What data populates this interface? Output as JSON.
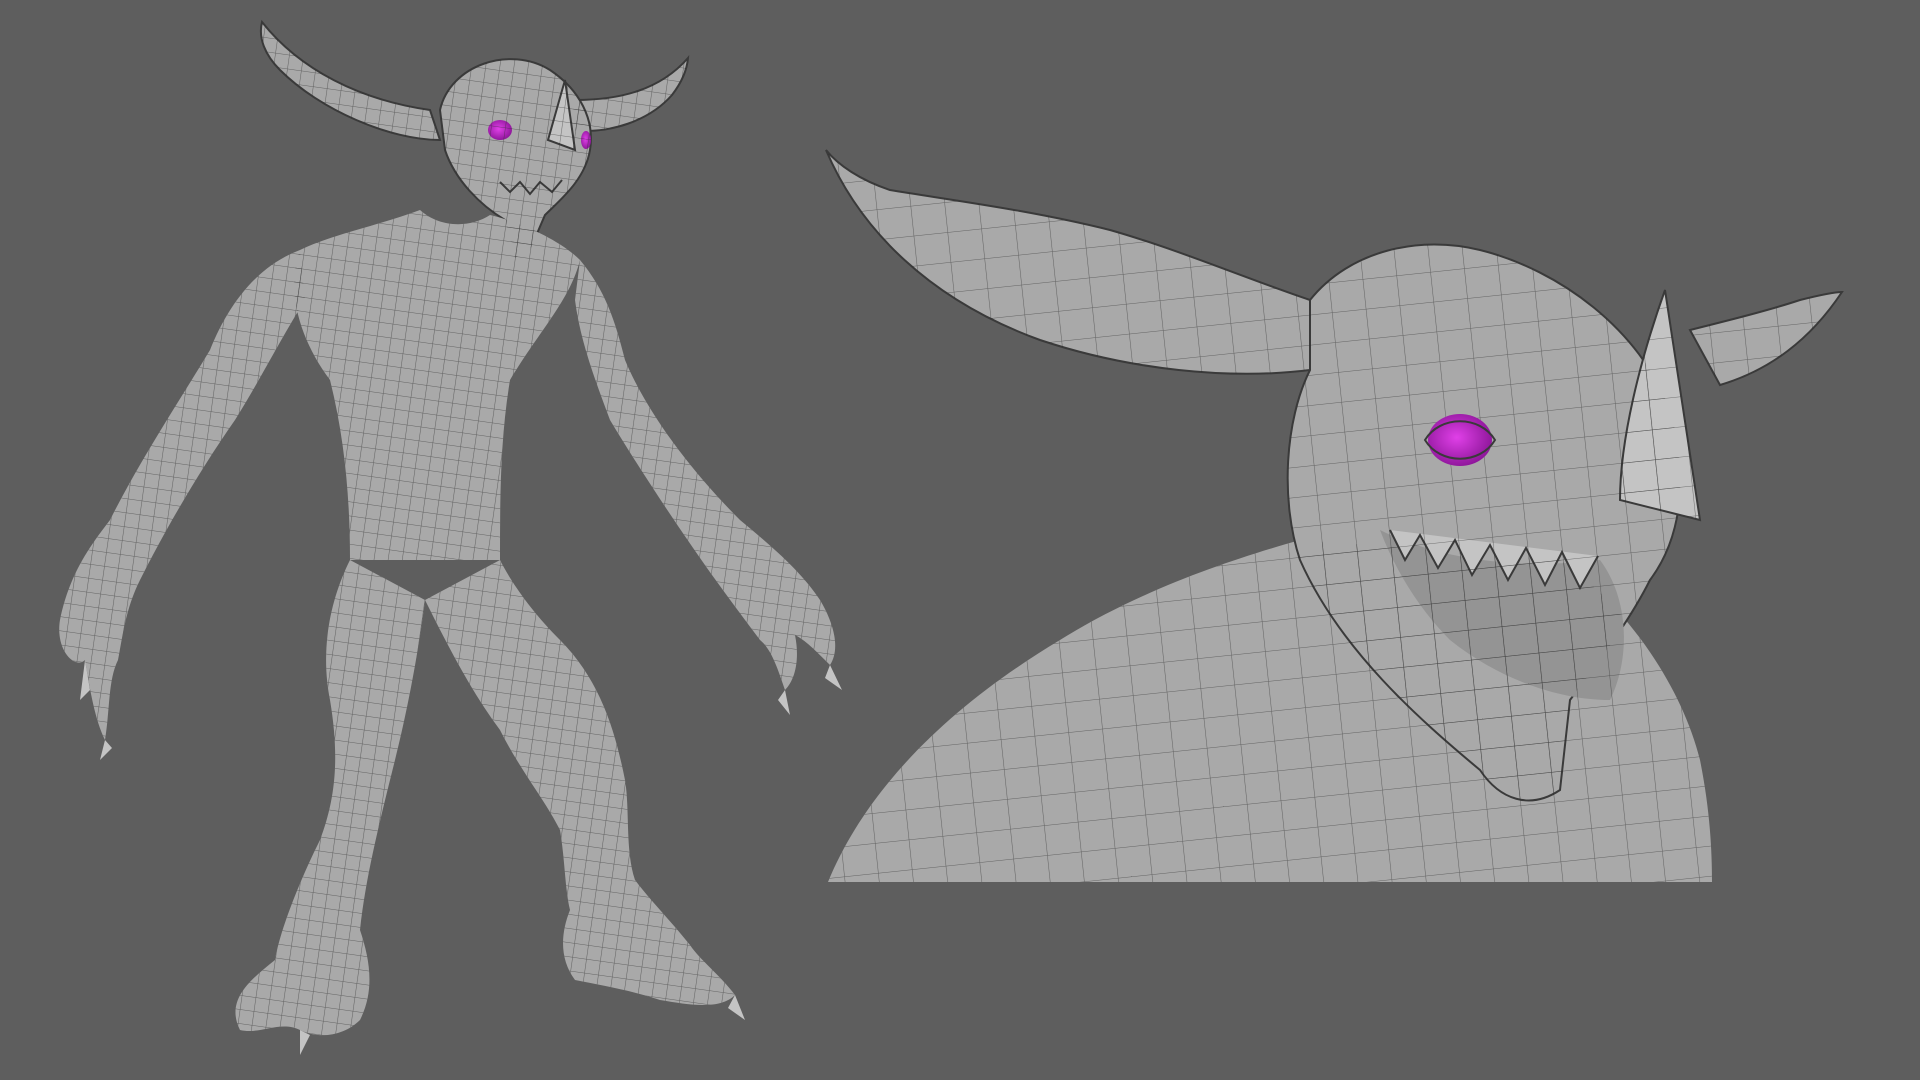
{
  "scene": {
    "background": "#5e5e5e",
    "mesh_color": "#a9a9a9",
    "wire_color": "#2b2b2b",
    "eye_color": "#b21fbf"
  },
  "views": [
    {
      "name": "full-body-view",
      "icon": "creature-full-body"
    },
    {
      "name": "head-closeup-view",
      "icon": "creature-head-closeup"
    }
  ]
}
